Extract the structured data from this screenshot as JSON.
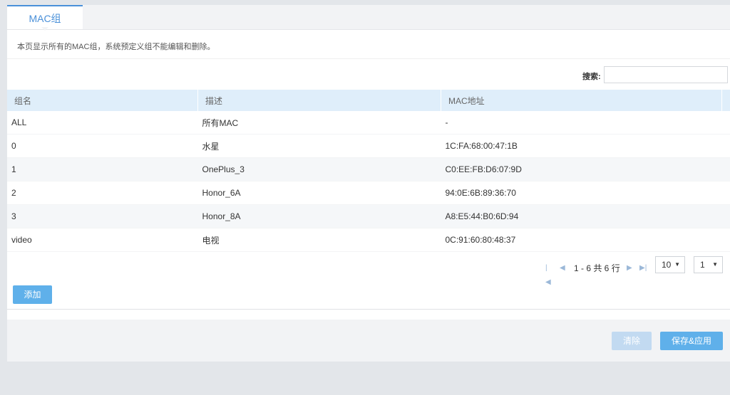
{
  "tabs": [
    {
      "label": "MAC组"
    }
  ],
  "description": "本页显示所有的MAC组，系统预定义组不能编辑和删除。",
  "search": {
    "label": "搜索:",
    "value": "",
    "placeholder": ""
  },
  "table": {
    "headers": [
      "组名",
      "描述",
      "MAC地址",
      ""
    ],
    "rows": [
      {
        "name": "ALL",
        "desc": "所有MAC",
        "mac": "-"
      },
      {
        "name": "0",
        "desc": "水星",
        "mac": "1C:FA:68:00:47:1B"
      },
      {
        "name": "1",
        "desc": "OnePlus_3",
        "mac": "C0:EE:FB:D6:07:9D"
      },
      {
        "name": "2",
        "desc": "Honor_6A",
        "mac": "94:0E:6B:89:36:70"
      },
      {
        "name": "3",
        "desc": "Honor_8A",
        "mac": "A8:E5:44:B0:6D:94"
      },
      {
        "name": "video",
        "desc": "电视",
        "mac": "0C:91:60:80:48:37"
      }
    ]
  },
  "pager": {
    "summary": "1 - 6 共 6 行",
    "page_size": "10",
    "page": "1"
  },
  "buttons": {
    "add": "添加",
    "clear": "清除",
    "save_apply": "保存&应用"
  },
  "icons": {
    "edit": "pencil-icon",
    "delete": "close-icon",
    "first": "first-page-icon",
    "prev": "prev-page-icon",
    "next": "next-page-icon",
    "last": "last-page-icon"
  },
  "colors": {
    "accent": "#4a90d9",
    "header_bg": "#dfeefa",
    "button": "#5fb0ea",
    "button_disabled": "#c2daf1"
  }
}
